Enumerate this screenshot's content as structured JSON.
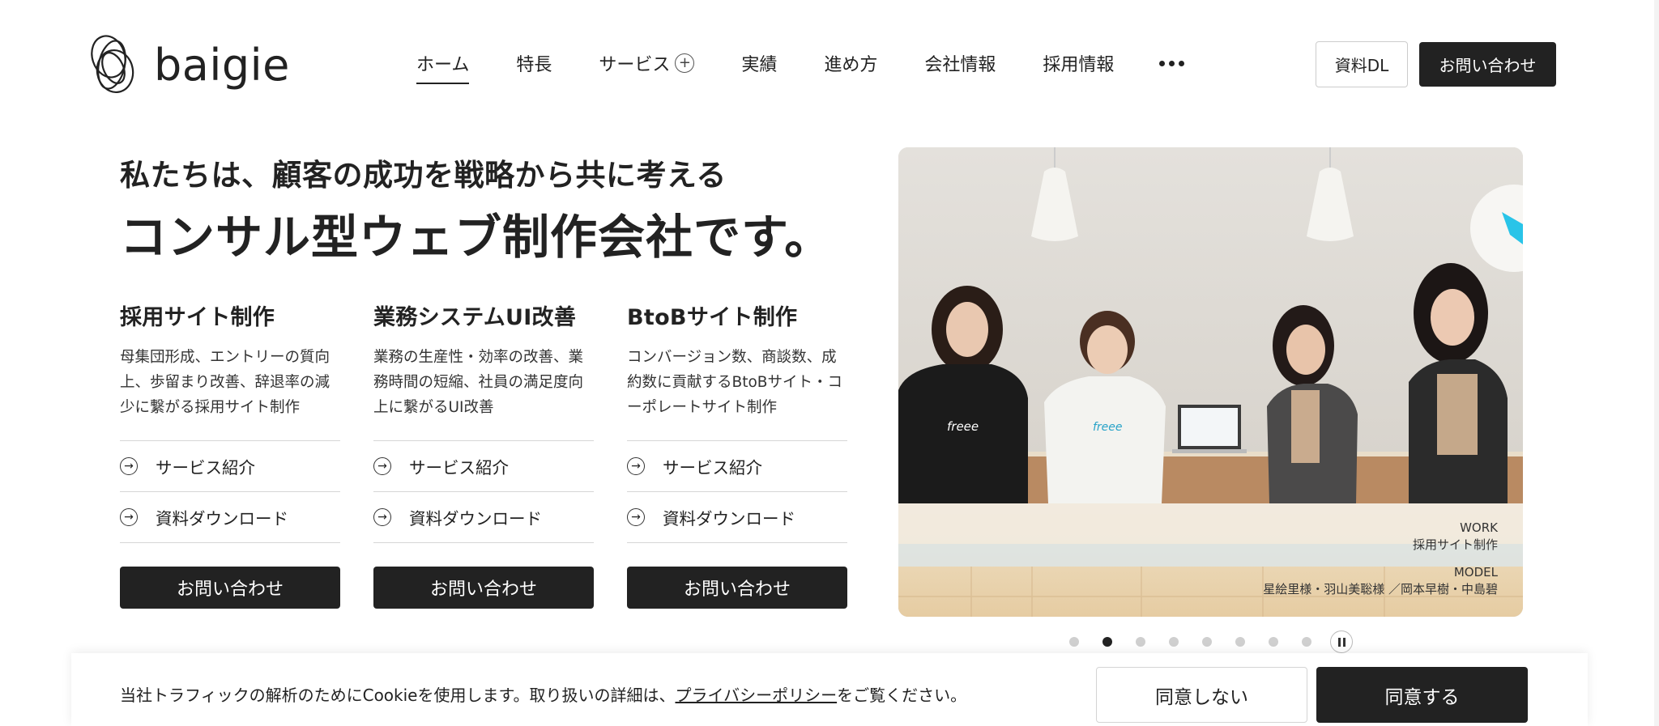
{
  "brand": {
    "name": "baigie"
  },
  "nav": {
    "items": [
      {
        "label": "ホーム"
      },
      {
        "label": "特長"
      },
      {
        "label": "サービス"
      },
      {
        "label": "実績"
      },
      {
        "label": "進め方"
      },
      {
        "label": "会社情報"
      },
      {
        "label": "採用情報"
      }
    ],
    "download_label": "資料DL",
    "contact_label": "お問い合わせ"
  },
  "hero": {
    "subtitle": "私たちは、顧客の成功を戦略から共に考える",
    "title": "コンサル型ウェブ制作会社です。"
  },
  "services": [
    {
      "title": "採用サイト制作",
      "desc_lines": [
        "母集団形成、エントリーの質向",
        "上、歩留まり改善、辞退率の減",
        "少に繋がる採用サイト制作"
      ],
      "link1": "サービス紹介",
      "link2": "資料ダウンロード",
      "button": "お問い合わせ"
    },
    {
      "title": "業務システムUI改善",
      "desc_lines": [
        "業務の生産性・効率の改善、業",
        "務時間の短縮、社員の満足度向",
        "上に繋がるUI改善"
      ],
      "link1": "サービス紹介",
      "link2": "資料ダウンロード",
      "button": "お問い合わせ"
    },
    {
      "title": "BtoBサイト制作",
      "desc_lines": [
        "コンバージョン数、商談数、成",
        "約数に貢献するBtoBサイト・コ",
        "ーポレートサイト制作"
      ],
      "link1": "サービス紹介",
      "link2": "資料ダウンロード",
      "button": "お問い合わせ"
    }
  ],
  "slide": {
    "work_heading": "WORK",
    "work_value": "採用サイト制作",
    "model_heading": "MODEL",
    "model_value": "星絵里様・羽山美聡様 ／岡本早樹・中島碧",
    "shirt_logo": "freee",
    "total_slides": 8,
    "active_index": 1
  },
  "cookie": {
    "text_before": "当社トラフィックの解析のためにCookieを使用します。取り扱いの詳細は、",
    "policy_link": "プライバシーポリシー",
    "text_after": "をご覧ください。",
    "decline_label": "同意しない",
    "accept_label": "同意する"
  },
  "colors": {
    "primary_dark": "#222222",
    "brand_accent": "#29c4e8"
  }
}
